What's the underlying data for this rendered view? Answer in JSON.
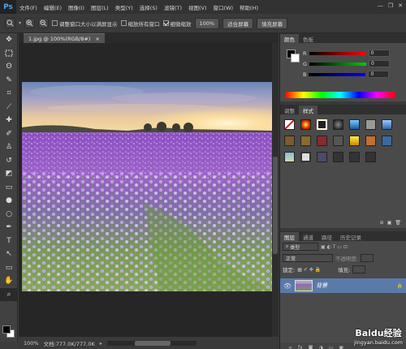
{
  "app": {
    "logo": "Ps"
  },
  "menu": {
    "items": [
      "文件(F)",
      "编辑(E)",
      "图像(I)",
      "图层(L)",
      "类型(Y)",
      "选择(S)",
      "滤镜(T)",
      "视图(V)",
      "窗口(W)",
      "帮助(H)"
    ]
  },
  "window_controls": {
    "minimize": "—",
    "restore": "❐",
    "close": "✕"
  },
  "options_bar": {
    "resize_windows_label": "调整窗口大小以满屏显示",
    "zoom_all_label": "缩放所有窗口",
    "scrubby_zoom_label": "细微缩放",
    "zoom_100_label": "100%",
    "fit_screen_label": "适合屏幕",
    "fill_screen_label": "填充屏幕"
  },
  "document": {
    "tab_title": "1.jpg @ 100%(RGB/8#)",
    "tab_close": "×"
  },
  "status": {
    "zoom": "100%",
    "doc_size": "文档:777.0K/777.0K"
  },
  "color_panel": {
    "tabs": [
      "颜色",
      "色板"
    ],
    "channels": [
      {
        "label": "R",
        "value": "0"
      },
      {
        "label": "G",
        "value": "0"
      },
      {
        "label": "B",
        "value": "0"
      }
    ],
    "colors": {
      "red": "#ff0000",
      "green": "#00c000",
      "blue": "#0000ff"
    }
  },
  "styles_panel": {
    "tabs": [
      "调整",
      "样式"
    ]
  },
  "layers_panel": {
    "tabs": [
      "图层",
      "通道",
      "路径",
      "历史记录"
    ],
    "filter_label": "类型",
    "blend_mode": "正常",
    "opacity_label": "不透明度:",
    "lock_label": "锁定:",
    "fill_label": "填充:",
    "layer_name": "背景"
  },
  "watermark": {
    "brand": "Baidu经验",
    "url": "jingyan.baidu.com"
  }
}
